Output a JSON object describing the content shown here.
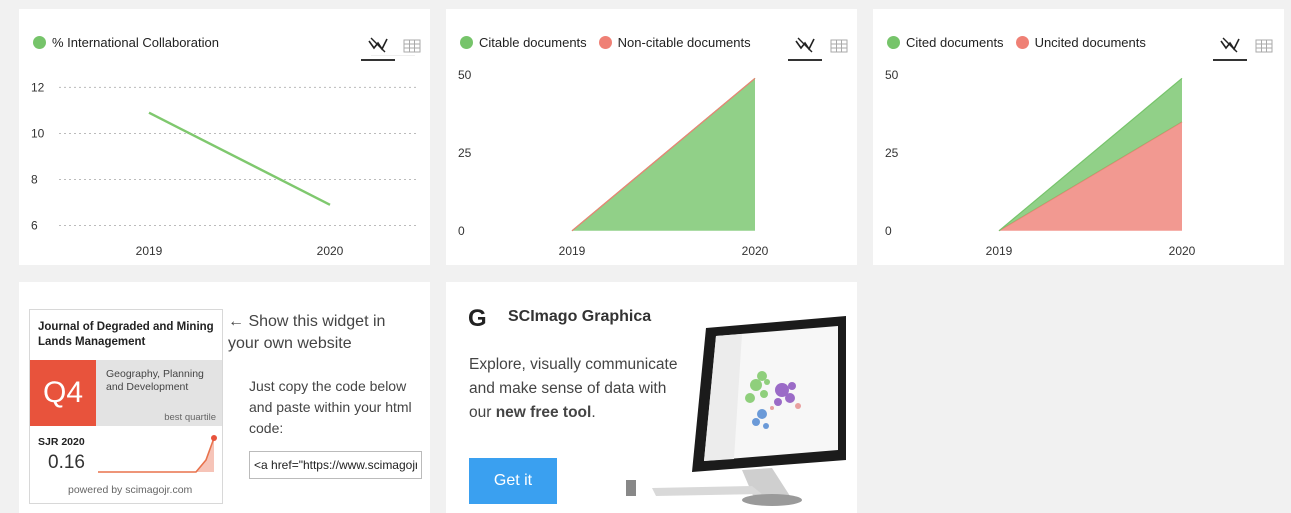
{
  "panel_collab": {
    "legend": "% International Collaboration",
    "colors": {
      "line": "#7fc86e"
    }
  },
  "panel_citable": {
    "legend": [
      {
        "label": "Citable documents",
        "color": "#76c46a"
      },
      {
        "label": "Non-citable documents",
        "color": "#ef8075"
      }
    ]
  },
  "panel_cited": {
    "legend": [
      {
        "label": "Cited documents",
        "color": "#76c46a"
      },
      {
        "label": "Uncited documents",
        "color": "#ef8075"
      }
    ]
  },
  "icons": {
    "chart": "line-chart-icon",
    "table": "table-grid-icon"
  },
  "chart_data": [
    {
      "type": "line",
      "x": [
        "2019",
        "2020"
      ],
      "series": [
        {
          "name": "% International Collaboration",
          "values": [
            10.9,
            6.9
          ]
        }
      ],
      "yticks": [
        "12",
        "10",
        "8",
        "6"
      ],
      "ylim": [
        5.5,
        12.8
      ],
      "grid": true
    },
    {
      "type": "area",
      "x": [
        "2019",
        "2020"
      ],
      "series": [
        {
          "name": "Citable documents",
          "values": [
            0,
            49
          ]
        },
        {
          "name": "Non-citable documents",
          "values": [
            0,
            0
          ]
        }
      ],
      "yticks": [
        "50",
        "25",
        "0"
      ],
      "ylim": [
        -2,
        52
      ],
      "stacked": true
    },
    {
      "type": "area",
      "x": [
        "2019",
        "2020"
      ],
      "series": [
        {
          "name": "Uncited documents",
          "values": [
            0,
            35
          ]
        },
        {
          "name": "Cited documents",
          "values": [
            0,
            14
          ]
        }
      ],
      "yticks": [
        "50",
        "25",
        "0"
      ],
      "ylim": [
        -2,
        52
      ],
      "stacked": true
    }
  ],
  "widget": {
    "title": "Journal of Degraded and Mining Lands Management",
    "quartile": "Q4",
    "category": "Geography, Planning and Development",
    "best_quartile": "best quartile",
    "sjr_label": "SJR 2020",
    "sjr_value": "0.16",
    "powered_by": "powered by scimagojr.com",
    "show_text": "← Show this widget in your own website",
    "copy_text": "Just copy the code below and paste within your html code:",
    "code_value": "<a href=\"https://www.scimagojr.com/journalsearch.php?"
  },
  "graphica": {
    "logo": "G",
    "title": "SCImago Graphica",
    "text_plain": "Explore, visually communicate and make sense of data with our ",
    "text_bold": "new free tool",
    "text_end": ".",
    "button": "Get it",
    "button_color": "#3aa0f0"
  }
}
